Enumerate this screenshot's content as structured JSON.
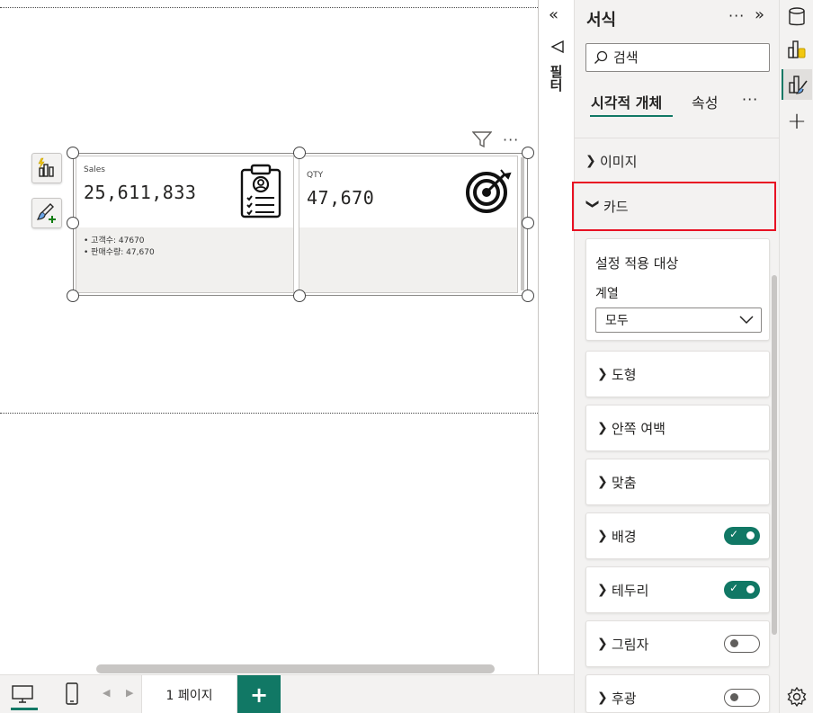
{
  "canvas": {
    "cards": [
      {
        "label": "Sales",
        "value": "25,611,833",
        "icon": "clipboard-person-icon",
        "notes": [
          "• 고객수: 47670",
          "• 판매수량: 47,670"
        ]
      },
      {
        "label": "QTY",
        "value": "47,670",
        "icon": "target-arrow-icon",
        "notes": []
      }
    ]
  },
  "filters": {
    "label": "필터"
  },
  "pane": {
    "title": "서식",
    "search_placeholder": "검색",
    "tabs": [
      {
        "label": "시각적 개체"
      },
      {
        "label": "속성"
      }
    ],
    "sections": {
      "image": "이미지",
      "card": "카드",
      "apply_settings": "설정 적용 대상",
      "series_label": "계열",
      "series_value": "모두",
      "shape": "도형",
      "padding": "안쪽 여백",
      "alignment": "맞춤",
      "background": "배경",
      "border": "테두리",
      "shadow": "그림자",
      "glow": "후광"
    },
    "toggles": {
      "background": true,
      "border": true,
      "shadow": false,
      "glow": false
    }
  },
  "bottom": {
    "page_tab": "1 페이지",
    "add_label": "+"
  }
}
